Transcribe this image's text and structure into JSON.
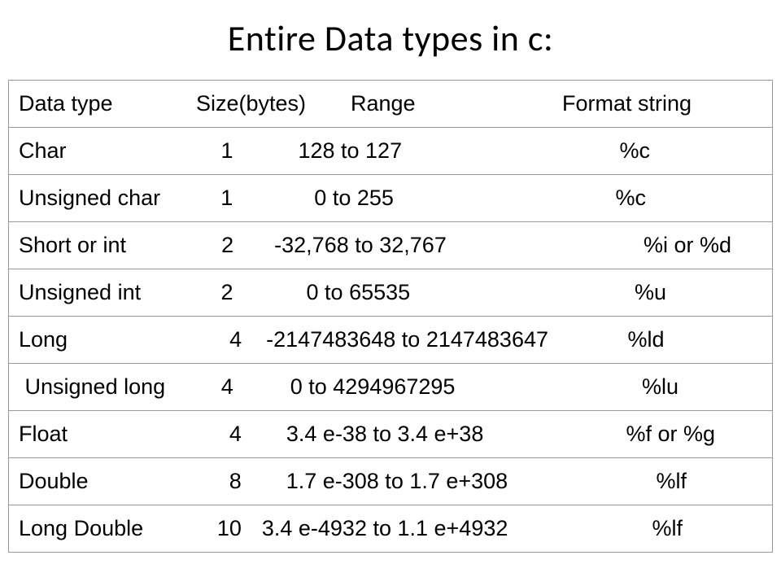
{
  "title": "Entire Data types in c:",
  "head": {
    "name": "Data type",
    "size": "Size(bytes)",
    "range": "Range",
    "format": "Format string"
  },
  "rows": [
    {
      "name": "Char",
      "size": "1",
      "range": "128 to 127",
      "format": "%c"
    },
    {
      "name": "Unsigned char",
      "size": "1",
      "range": "0 to 255",
      "format": "%c"
    },
    {
      "name": "Short or int",
      "size": "2",
      "range": "-32,768 to 32,767",
      "format": "%i or %d"
    },
    {
      "name": "Unsigned int",
      "size": "2",
      "range": "0 to 65535",
      "format": "%u"
    },
    {
      "name": "Long",
      "size": "4",
      "range": "-2147483648 to 2147483647",
      "format": "%ld"
    },
    {
      "name": " Unsigned long",
      "size": "4",
      "range": "0 to 4294967295",
      "format": "%lu"
    },
    {
      "name": "Float",
      "size": "4",
      "range": "3.4 e-38 to 3.4 e+38",
      "format": "%f or %g"
    },
    {
      "name": "Double",
      "size": "8",
      "range": "1.7 e-308 to 1.7 e+308",
      "format": "%lf"
    },
    {
      "name": "Long Double",
      "size": "10",
      "range": "3.4 e-4932 to 1.1 e+4932",
      "format": "%lf"
    }
  ]
}
